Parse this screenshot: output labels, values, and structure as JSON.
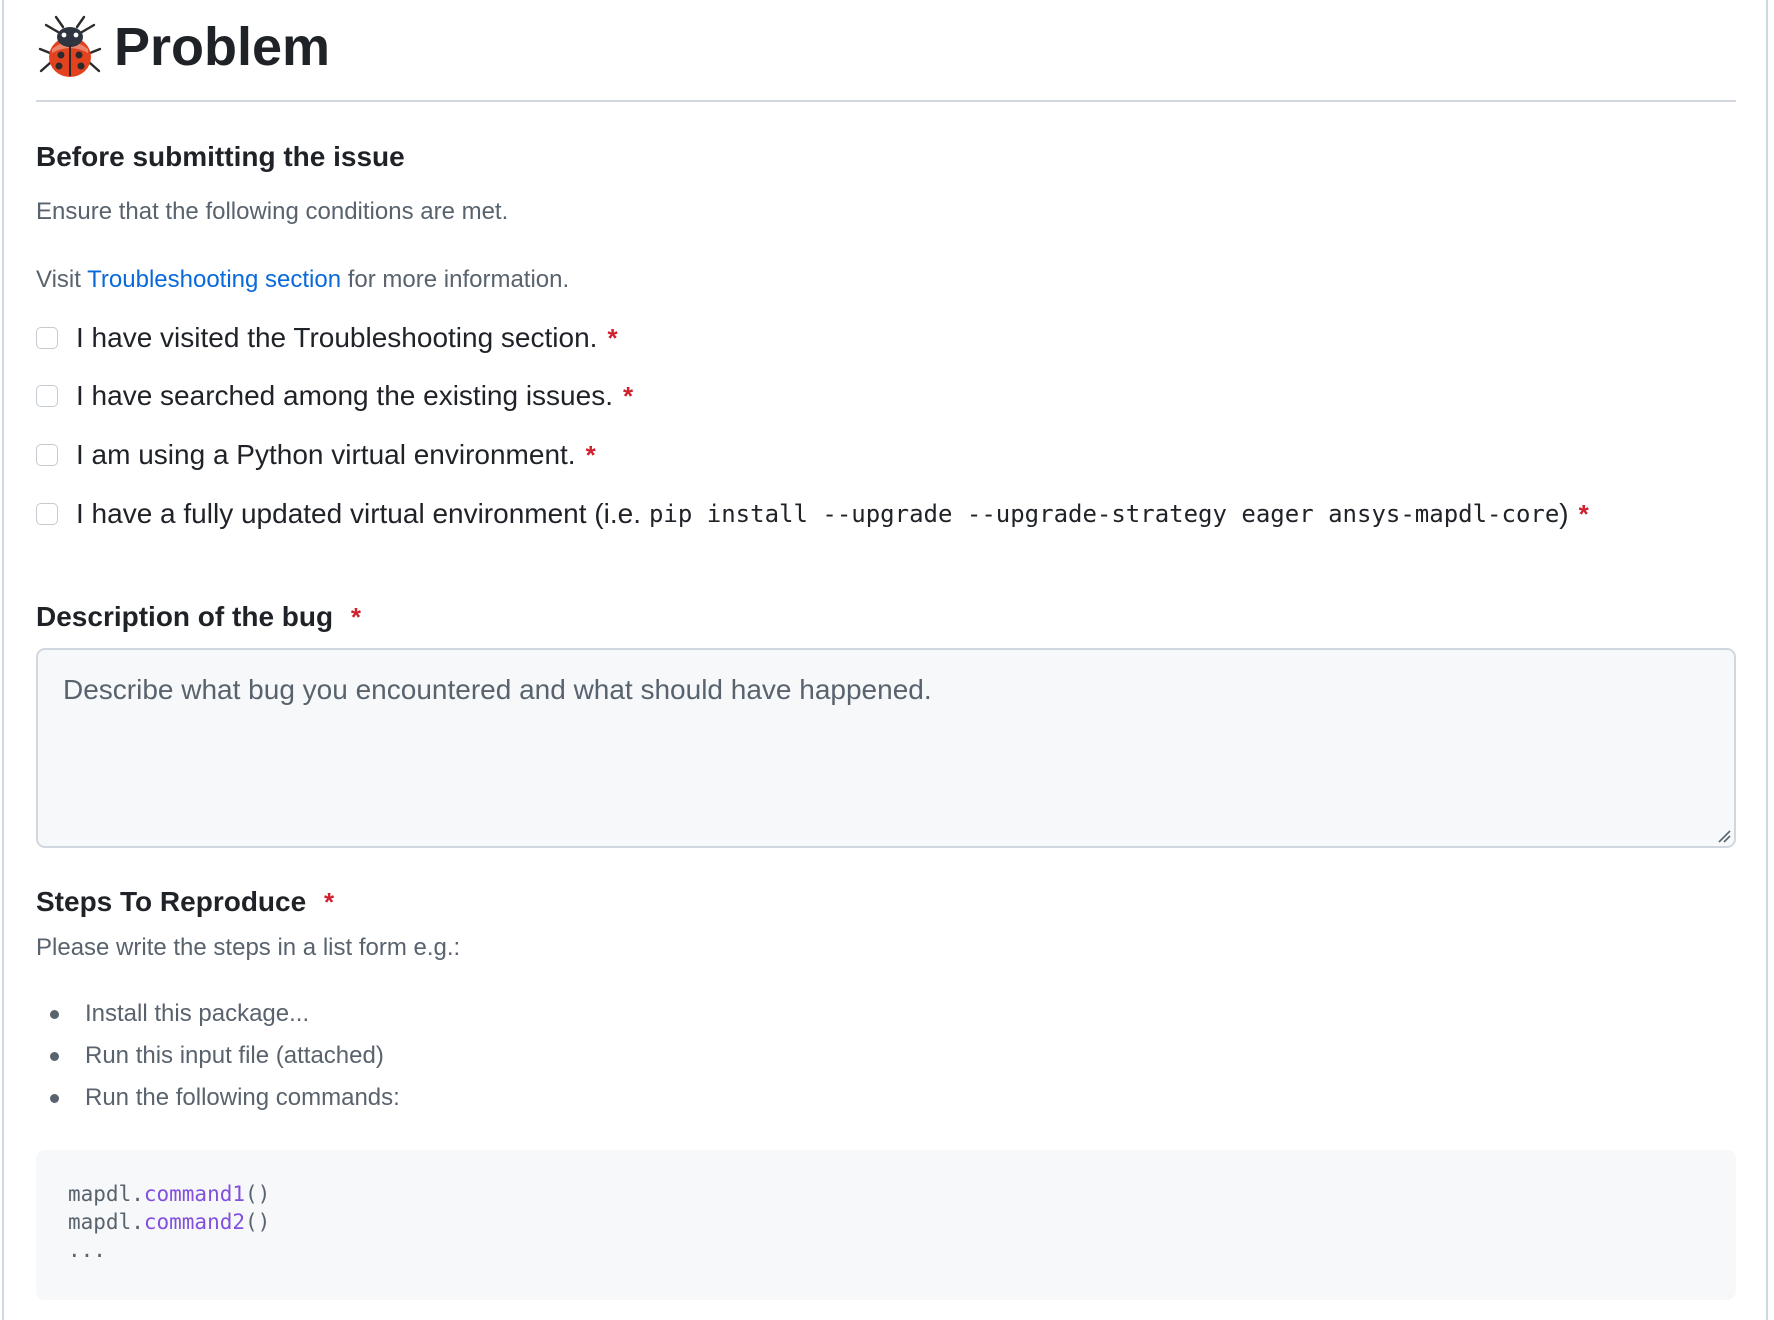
{
  "title": "Problem",
  "icons": {
    "title_icon": "ladybug-icon"
  },
  "colors": {
    "required": "#cf222e",
    "link": "#0969da",
    "muted": "#59636e",
    "function": "#8250df"
  },
  "before": {
    "heading": "Before submitting the issue",
    "intro": "Ensure that the following conditions are met.",
    "visit_prefix": "Visit",
    "visit_link": "Troubleshooting section",
    "visit_suffix": "for more information.",
    "checkboxes": [
      {
        "label": "I have visited the Troubleshooting section.",
        "checked": false,
        "required_mark": "*"
      },
      {
        "label": "I have searched among the existing issues.",
        "checked": false,
        "required_mark": "*"
      },
      {
        "label": "I am using a Python virtual environment.",
        "checked": false,
        "required_mark": "*"
      },
      {
        "label_prefix": "I have a fully updated virtual environment (i.e.",
        "code": "pip install --upgrade --upgrade-strategy eager ansys-mapdl-core",
        "label_suffix": ")",
        "checked": false,
        "required_mark": "*"
      }
    ]
  },
  "description": {
    "label": "Description of the bug",
    "required_mark": "*",
    "placeholder": "Describe what bug you encountered and what should have happened.",
    "value": ""
  },
  "steps": {
    "label": "Steps To Reproduce",
    "required_mark": "*",
    "hint": "Please write the steps in a list form e.g.:",
    "items": [
      "Install this package...",
      "Run this input file (attached)",
      "Run the following commands:"
    ],
    "code_lines": [
      {
        "obj": "mapdl.",
        "fn": "command1",
        "args": "()"
      },
      {
        "obj": "mapdl.",
        "fn": "command2",
        "args": "()"
      },
      {
        "obj": "...",
        "fn": "",
        "args": ""
      }
    ]
  }
}
